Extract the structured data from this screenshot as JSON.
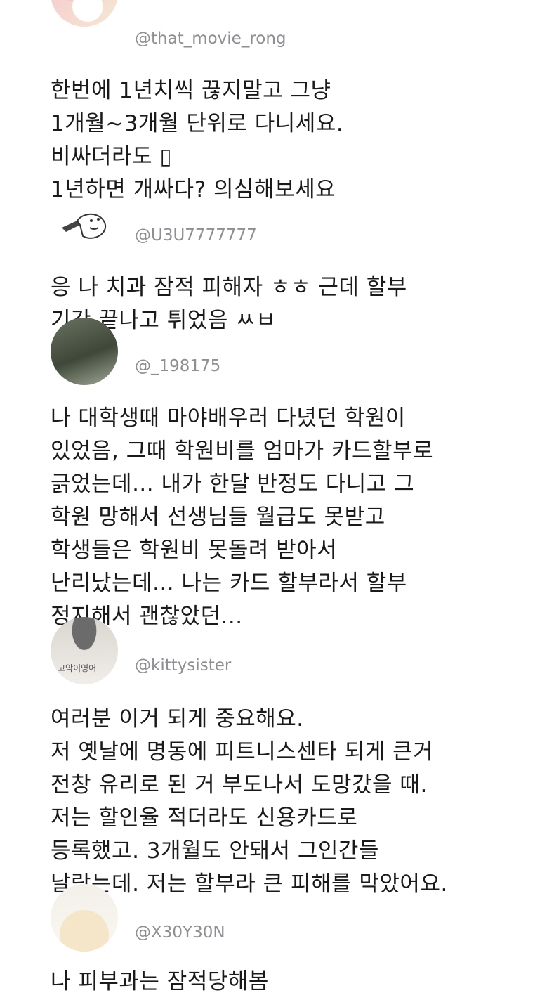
{
  "tweets": [
    {
      "handle": "@that_movie_rong",
      "text": "한번에 1년치씩 끊지말고 그냥\n1개월~3개월 단위로 다니세요.\n비싸더라도 ▯\n1년하면 개싸다? 의심해보세요",
      "avatar_icon": "plush-toy-avatar"
    },
    {
      "handle": "@U3U7777777",
      "text": "응 나 치과 잠적 피해자 ㅎㅎ 근데 할부\n기간 끝나고 튀었음 ㅆㅂ",
      "avatar_icon": "doodle-avatar"
    },
    {
      "handle": "@_198175",
      "text": "나 대학생때 마야배우러 다녔던 학원이\n있었음, 그때 학원비를 엄마가 카드할부로\n긁었는데... 내가 한달 반정도 다니고 그\n학원 망해서 선생님들 월급도 못받고\n학생들은 학원비 못돌려 받아서\n난리났는데... 나는 카드 할부라서 할부\n정지해서 괜찮았던...",
      "avatar_icon": "photo-avatar"
    },
    {
      "handle": "@kittysister",
      "text": "여러분 이거 되게 중요해요.\n저 옛날에 명동에 피트니스센타 되게 큰거\n전창 유리로 된 거 부도나서 도망갔을 때.\n저는 할인율 적더라도 신용카드로\n등록했고. 3개월도 안돼서 그인간들\n날랐는데. 저는 할부라 큰 피해를 막았어요.",
      "avatar_icon": "sketch-avatar",
      "avatar_caption": "고악이영어"
    },
    {
      "handle": "@X30Y30N",
      "text": "나 피부과는 잠적당해봄",
      "avatar_icon": "face-avatar"
    }
  ]
}
